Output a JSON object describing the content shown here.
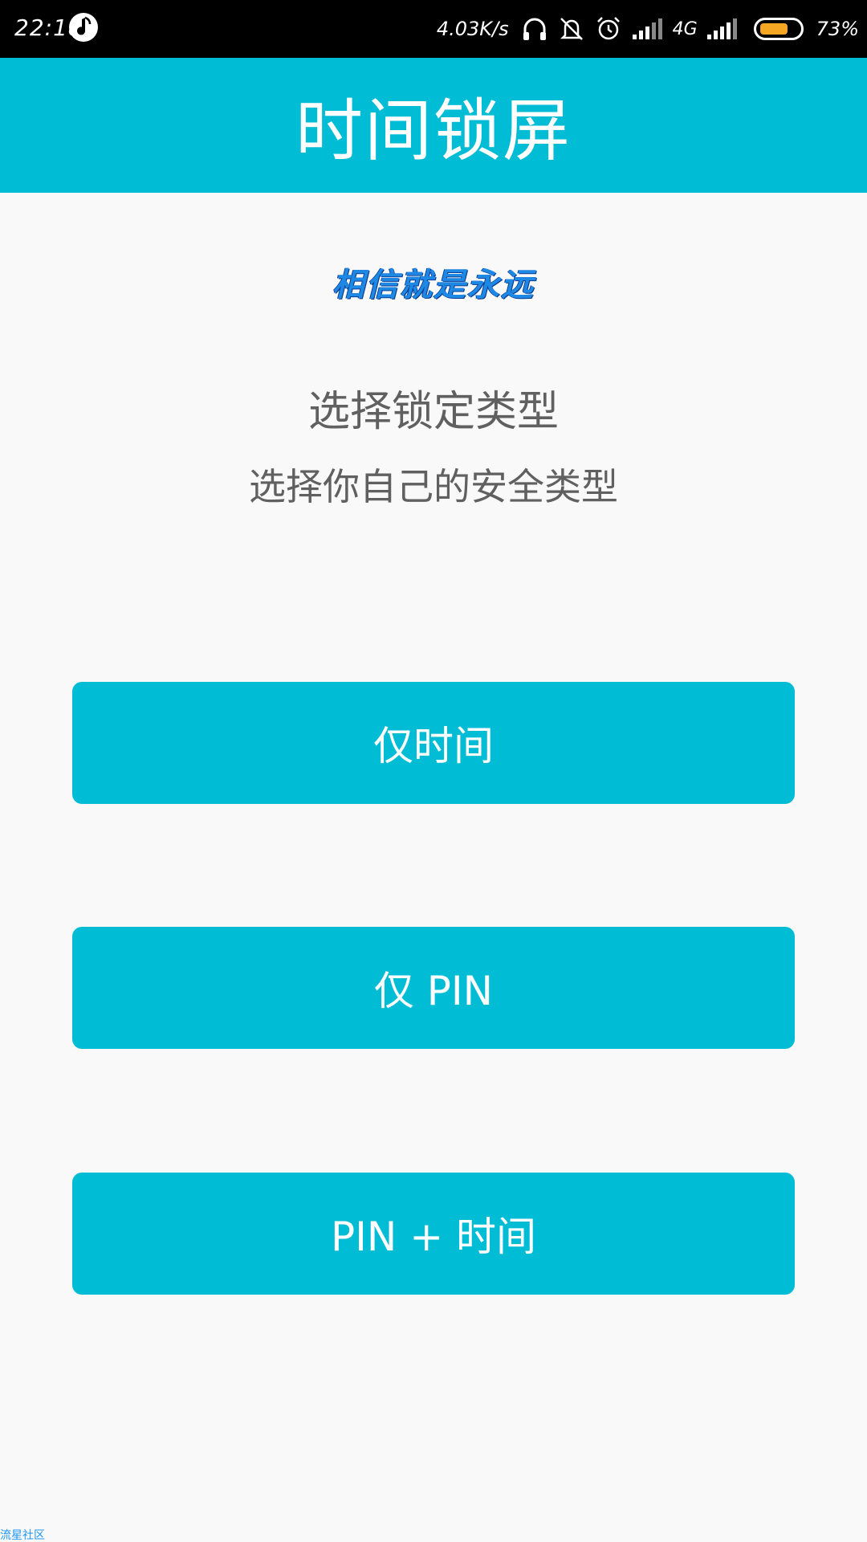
{
  "status_bar": {
    "time": "22:18",
    "net_speed": "4.03K/s",
    "network_type": "4G",
    "battery_percent": "73%",
    "battery_level": 0.73,
    "battery_color": "#f5a623",
    "icons": [
      "music-app-icon",
      "headphones-icon",
      "bell-off-icon",
      "alarm-icon",
      "signal-icon",
      "signal-icon"
    ]
  },
  "header": {
    "title": "时间锁屏",
    "background": "#00bcd4"
  },
  "main": {
    "slogan": "相信就是永远",
    "heading": "选择锁定类型",
    "subheading": "选择你自己的安全类型",
    "options": [
      {
        "label": "仅时间"
      },
      {
        "label": "仅 PIN"
      },
      {
        "label": "PIN + 时间"
      }
    ],
    "button_color": "#00bcd4"
  },
  "watermark": "流星社区"
}
